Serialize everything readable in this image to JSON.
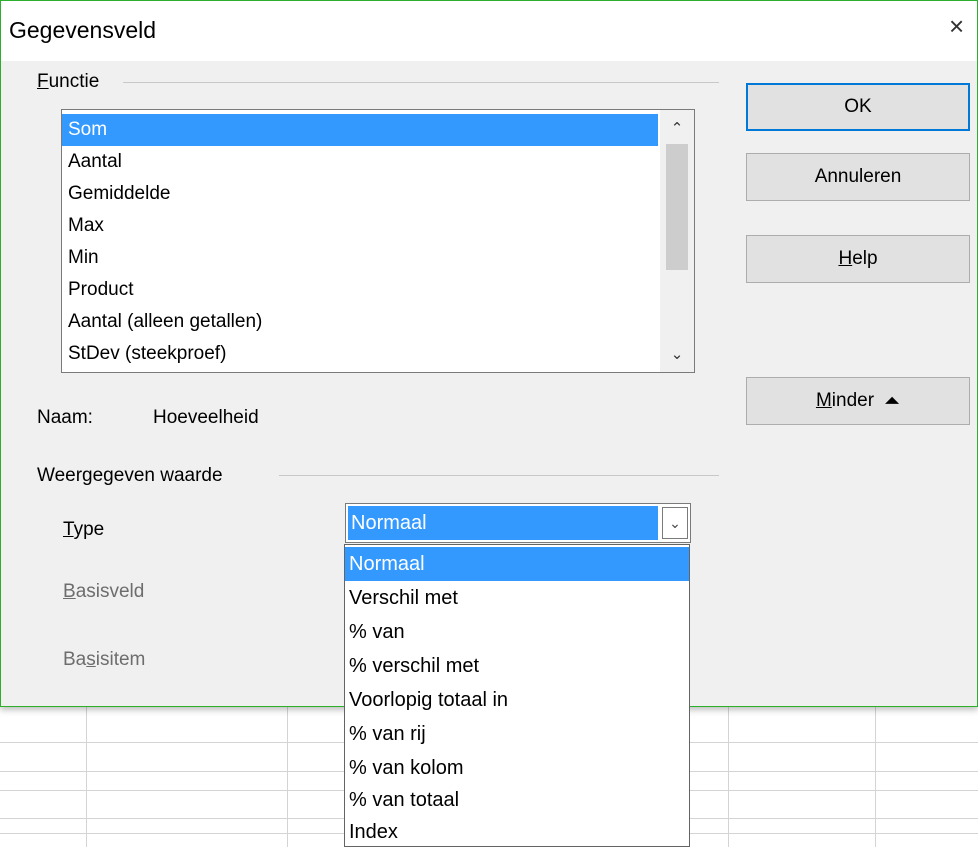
{
  "dialog": {
    "title": "Gegevensveld",
    "close_glyph": "×",
    "border_color": "#2cb02c"
  },
  "functie": {
    "group_label": "Functie",
    "items": [
      "Som",
      "Aantal",
      "Gemiddelde",
      "Max",
      "Min",
      "Product",
      "Aantal (alleen getallen)",
      "StDev (steekproef)"
    ],
    "selected": "Som",
    "scroll_up_glyph": "⌃",
    "scroll_down_glyph": "⌄"
  },
  "buttons": {
    "ok": "OK",
    "cancel": "Annuleren",
    "help": "Help",
    "minder": "Minder",
    "minder_icon": "⏶"
  },
  "naam": {
    "label": "Naam:",
    "value": "Hoeveelheid"
  },
  "weergegeven": {
    "group_label": "Weergegeven waarde",
    "type_label": "Type",
    "basisveld_label": "Basisveld",
    "basisitem_label": "Basisitem",
    "type_value": "Normaal",
    "dropdown_glyph": "⌄",
    "options": [
      "Normaal",
      "Verschil met",
      "% van",
      "% verschil met",
      "Voorlopig totaal in",
      "% van rij",
      "% van kolom",
      "% van totaal",
      "Index"
    ],
    "selected_option": "Normaal"
  },
  "colors": {
    "selection": "#3399ff",
    "default_button_border": "#0078d7"
  }
}
